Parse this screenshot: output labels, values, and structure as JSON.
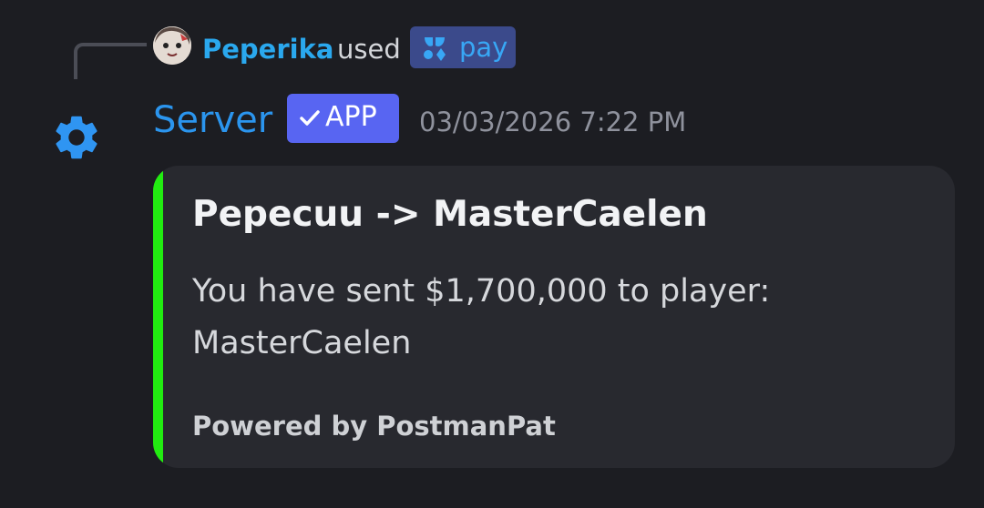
{
  "reply": {
    "username": "Peperika",
    "used_text": "used",
    "command": {
      "icon": "pay-command-icon",
      "label": "pay"
    }
  },
  "message": {
    "author": "Server",
    "author_icon": "gear-icon",
    "badge": "APP",
    "timestamp": "03/03/2026 7:22 PM"
  },
  "embed": {
    "accent_color": "#22ec11",
    "title": "Pepecuu -> MasterCaelen",
    "description": "You have sent $1,700,000 to player: MasterCaelen",
    "footer": "Powered by PostmanPat"
  },
  "colors": {
    "background": "#1c1d22",
    "embed_background": "#28292f",
    "username": "#2aa8ee",
    "author": "#2b95ee",
    "app_badge": "#5865f2",
    "command_pill": "#3b4a8b"
  }
}
